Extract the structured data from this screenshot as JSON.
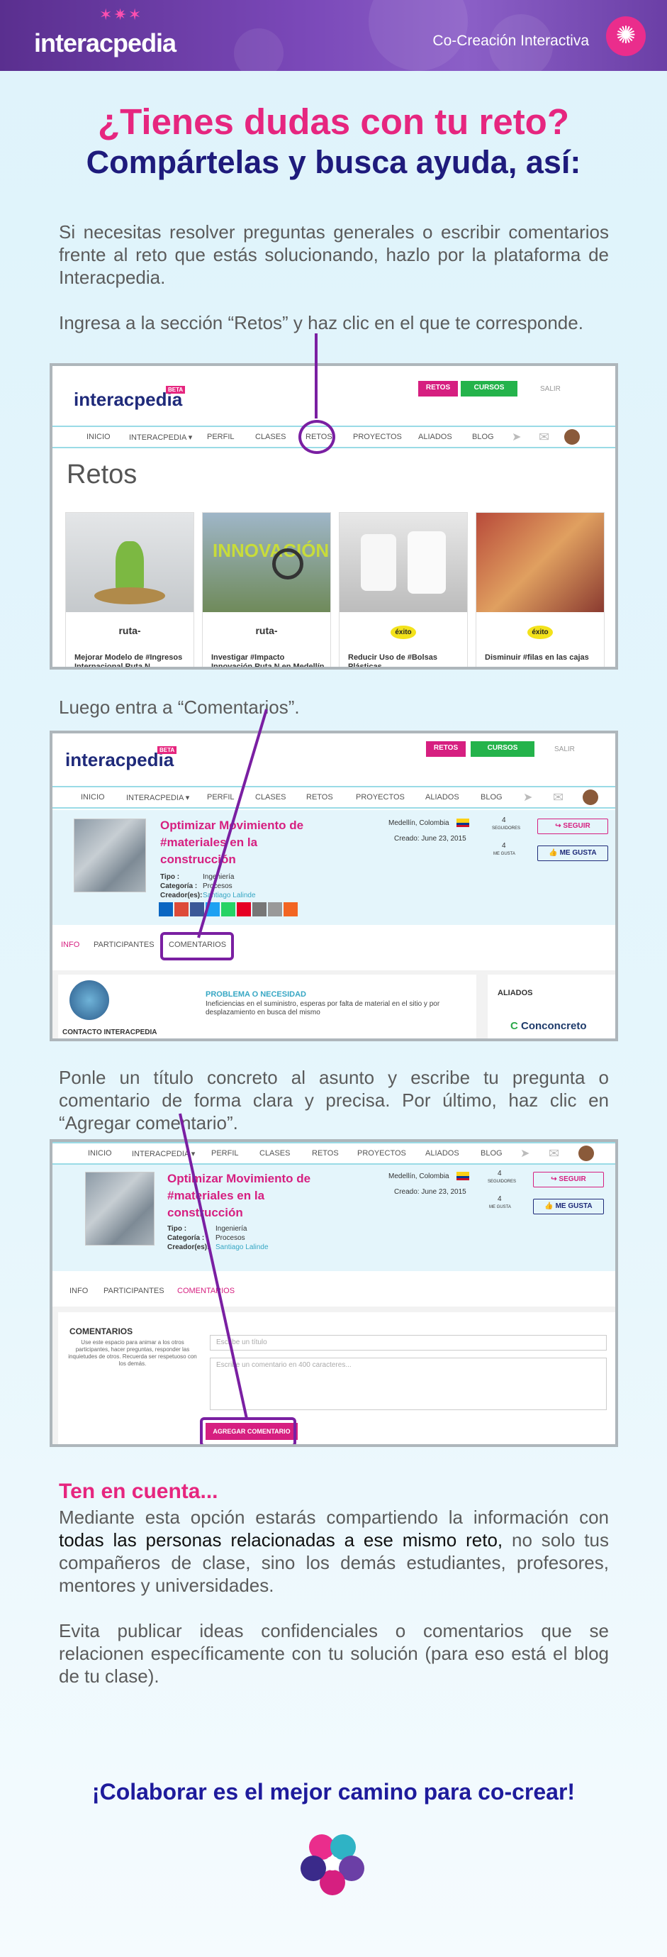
{
  "header": {
    "logo_text": "interacpedia",
    "tagline": "Co-Creación Interactiva"
  },
  "titles": {
    "line1": "¿Tienes dudas con tu reto?",
    "line2": "Compártelas y busca ayuda, así:"
  },
  "intro": "Si necesitas resolver preguntas generales o escribir comentarios frente al reto que estás solucionando, hazlo por la plataforma de Interacpedia.",
  "step1": "Ingresa a la sección “Retos” y haz clic en el que te corresponde.",
  "step2": "Luego entra a “Comentarios”.",
  "step3": "Ponle un título concreto al asunto y escribe tu pregunta o comentario de forma clara y precisa. Por último, haz clic en “Agregar comentario”.",
  "shot1": {
    "logo": "interacpedia",
    "beta": "BETA",
    "retos_btn": "RETOS",
    "cursos_btn": "CURSOS",
    "salir": "SALIR",
    "nav": [
      "INICIO",
      "INTERACPEDIA ▾",
      "PERFIL",
      "CLASES",
      "RETOS",
      "PROYECTOS",
      "ALIADOS",
      "BLOG"
    ],
    "heading": "Retos",
    "cards": [
      {
        "brand": "ruta-",
        "title": "Mejorar Modelo de #Ingresos Internacional Ruta N"
      },
      {
        "brand": "ruta-",
        "title": "Investigar #Impacto Innovación Ruta N en Medellín"
      },
      {
        "brand": "éxito",
        "title": "Reducir Uso de #Bolsas Plásticas"
      },
      {
        "brand": "éxito",
        "title": "Disminuir #filas en las cajas"
      }
    ],
    "card2_overlay": "INNOVACIÓN"
  },
  "shot2": {
    "logo": "interacpedia",
    "beta": "BETA",
    "retos_btn": "RETOS",
    "cursos_btn": "CURSOS",
    "salir": "SALIR",
    "nav": [
      "INICIO",
      "INTERACPEDIA ▾",
      "PERFIL",
      "CLASES",
      "RETOS",
      "PROYECTOS",
      "ALIADOS",
      "BLOG"
    ],
    "challenge_title": "Optimizar Movimiento de #materiales en la construcción",
    "meta": [
      "Tipo :",
      "Ingeniería",
      "Categoría :",
      "Procesos",
      "Creador(es):",
      "Santiago Lalinde"
    ],
    "location": "Medellín, Colombia",
    "created": "Creado: June 23, 2015",
    "seguidores_count": "4",
    "seguidores_label": "SEGUIDORES",
    "megusta_count": "4",
    "megusta_label": "ME GUSTA",
    "seguir_btn": "SEGUIR",
    "megusta_btn": "ME GUSTA",
    "tabs": [
      "INFO",
      "PARTICIPANTES",
      "COMENTARIOS"
    ],
    "contact_label": "CONTACTO INTERACPEDIA",
    "problem_title": "PROBLEMA O NECESIDAD",
    "problem_text": "Ineficiencias en el suministro, esperas por falta de material en el sitio y por desplazamiento en busca del mismo",
    "allies_label": "ALIADOS",
    "ally": "Conconcreto"
  },
  "shot3": {
    "nav": [
      "INICIO",
      "INTERACPEDIA ▾",
      "PERFIL",
      "CLASES",
      "RETOS",
      "PROYECTOS",
      "ALIADOS",
      "BLOG"
    ],
    "challenge_title": "Optimizar Movimiento de #materiales en la construcción",
    "meta": [
      "Tipo :",
      "Ingeniería",
      "Categoría :",
      "Procesos",
      "Creador(es):",
      "Santiago Lalinde"
    ],
    "location": "Medellín, Colombia",
    "created": "Creado: June 23, 2015",
    "seguidores_count": "4",
    "seguidores_label": "SEGUIDORES",
    "megusta_count": "4",
    "megusta_label": "ME GUSTA",
    "seguir_btn": "SEGUIR",
    "megusta_btn": "ME GUSTA",
    "tabs": [
      "INFO",
      "PARTICIPANTES",
      "COMENTARIOS"
    ],
    "comments_heading": "COMENTARIOS",
    "comments_help": "Use este espacio para animar a los otros participantes, hacer preguntas, responder las inquietudes de otros. Recuerda ser respetuoso con los demás.",
    "title_placeholder": "Escribe un título",
    "comment_placeholder": "Escribe un comentario en 400 caracteres...",
    "add_btn": "AGREGAR COMENTARIO"
  },
  "note": {
    "heading": "Ten en cuenta...",
    "p1_a": "Mediante esta opción estarás compartiendo la información con ",
    "p1_b": "todas las personas relacionadas a ese mismo reto,",
    "p1_c": " no solo tus compañeros de clase, sino los demás estudiantes, profesores, mentores y universidades.",
    "p2": "Evita publicar ideas confidenciales o comentarios que se relacionen específicamente con tu solución (para eso está el blog de tu clase)."
  },
  "closing": "¡Colaborar es el mejor camino para co-crear!",
  "colors": {
    "pink": "#e6267f",
    "navy": "#1e1b7c",
    "purple": "#7a1fa2",
    "header": "#6b3fa6"
  }
}
